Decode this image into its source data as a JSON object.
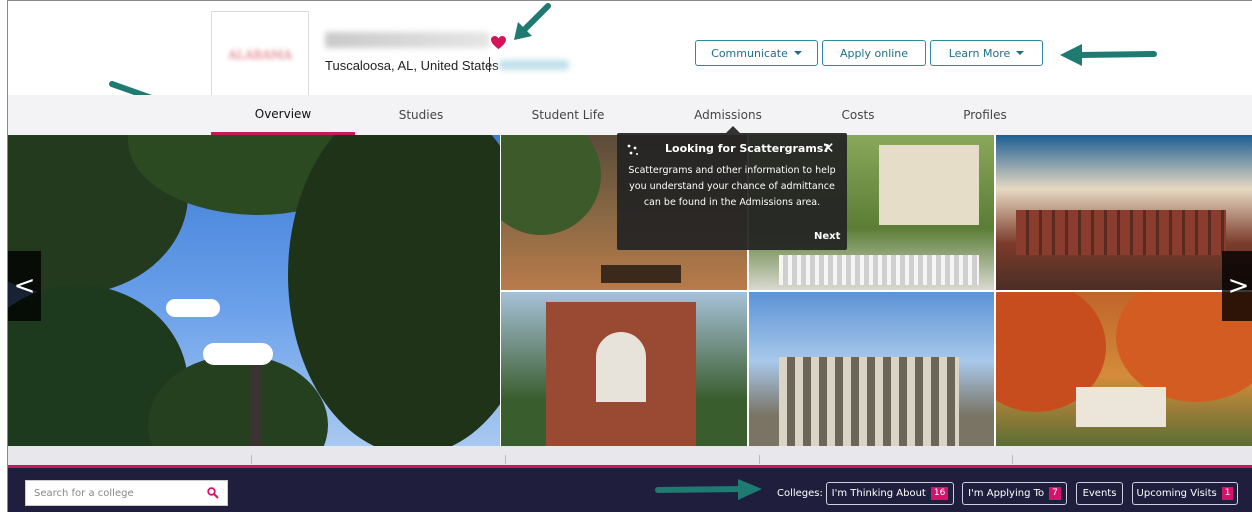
{
  "header": {
    "logo_text": "ALABAMA",
    "college_name": "The University of Alabama",
    "location": "Tuscaloosa, AL, United States",
    "location_separator": "|",
    "buttons": {
      "communicate": "Communicate",
      "apply": "Apply online",
      "learn_more": "Learn More"
    }
  },
  "tabs": [
    {
      "label": "Overview",
      "active": true
    },
    {
      "label": "Studies",
      "active": false
    },
    {
      "label": "Student Life",
      "active": false
    },
    {
      "label": "Admissions",
      "active": false
    },
    {
      "label": "Costs",
      "active": false
    },
    {
      "label": "Profiles",
      "active": false
    }
  ],
  "gallery": {
    "prev_label": "<",
    "next_label": ">"
  },
  "tooltip": {
    "title": "Looking for Scattergrams?",
    "body": "Scattergrams and other information to help you understand your chance of admittance can be found in the Admissions area.",
    "next": "Next",
    "close": "✕"
  },
  "footer": {
    "search_placeholder": "Search for a college",
    "colleges_label": "Colleges:",
    "buttons": [
      {
        "label": "I'm Thinking About",
        "count": "16"
      },
      {
        "label": "I'm Applying To",
        "count": "7"
      },
      {
        "label": "Events",
        "count": ""
      },
      {
        "label": "Upcoming Visits",
        "count": "1"
      }
    ]
  },
  "colors": {
    "accent": "#c8175f",
    "teal": "#1e6f86",
    "footer_bg": "#1f1f3d",
    "annotation_arrow": "#1f7a72"
  },
  "icons": [
    "heart-icon",
    "caret-down-icon",
    "search-icon",
    "close-icon",
    "sparkle-icon"
  ]
}
